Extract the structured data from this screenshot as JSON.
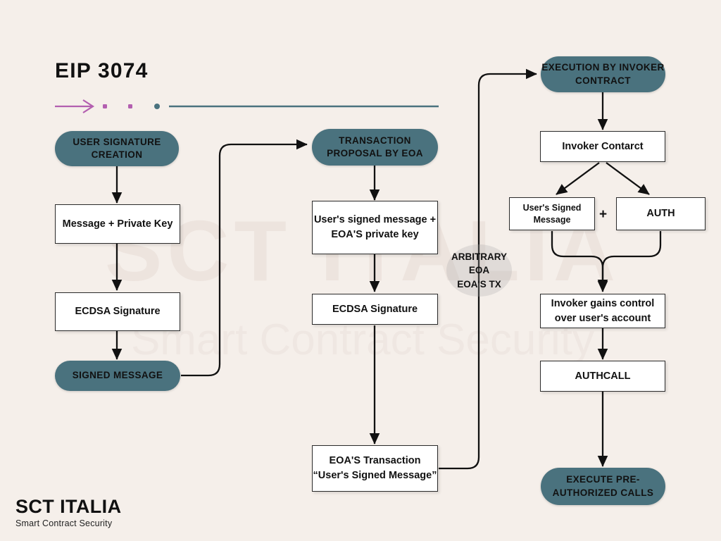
{
  "header": {
    "title": "EIP 3074",
    "divider": {
      "arrow_color": "#B35FB0",
      "dot1_color": "#B35FB0",
      "dot2_color": "#B35FB0",
      "dot3_color": "#4A727E",
      "line_color": "#4A727E"
    }
  },
  "theme": {
    "background": "#F5EFEA",
    "pill_fill": "#4A727E",
    "box_fill": "#FFFFFF",
    "box_border": "#2B2B2B",
    "text": "#111111",
    "blob_fill": "#AAAAAA",
    "connector": "#111111",
    "accent_purple": "#B35FB0"
  },
  "watermark": {
    "title": "SCT ITALIA",
    "subtitle": "Smart Contract Security"
  },
  "flow": {
    "columns": [
      {
        "name": "user-signature-creation",
        "nodes": [
          {
            "id": "user-signature-creation",
            "label": "USER SIGNATURE CREATION",
            "shape": "pill"
          },
          {
            "id": "message-private-key",
            "label": "Message + Private Key",
            "shape": "box"
          },
          {
            "id": "ecdsa-signature-1",
            "label": "ECDSA Signature",
            "shape": "box"
          },
          {
            "id": "signed-message",
            "label": "SIGNED MESSAGE",
            "shape": "pill"
          }
        ]
      },
      {
        "name": "transaction-proposal",
        "nodes": [
          {
            "id": "transaction-proposal-by-eoa",
            "label": "TRANSACTION PROPOSAL BY EOA",
            "shape": "pill"
          },
          {
            "id": "users-signed-message-eoa-key",
            "label": "User's signed message + EOA'S private key",
            "shape": "box"
          },
          {
            "id": "ecdsa-signature-2",
            "label": "ECDSA Signature",
            "shape": "box"
          },
          {
            "id": "eoas-transaction",
            "label": "EOA'S Transaction “User's Signed Message”",
            "shape": "box"
          }
        ]
      },
      {
        "name": "execution-by-invoker",
        "nodes": [
          {
            "id": "execution-by-invoker-contract",
            "label": "EXECUTION BY INVOKER CONTRACT",
            "shape": "pill"
          },
          {
            "id": "invoker-contarct",
            "label": "Invoker Contarct",
            "shape": "box"
          },
          {
            "id": "users-signed-message",
            "label": "User's Signed Message",
            "shape": "box"
          },
          {
            "id": "auth",
            "label": "AUTH",
            "shape": "box"
          },
          {
            "id": "invoker-gains-control",
            "label": "Invoker gains control over user's account",
            "shape": "box"
          },
          {
            "id": "authcall",
            "label": "AUTHCALL",
            "shape": "box"
          },
          {
            "id": "execute-pre-authorized-calls",
            "label": "EXECUTE PRE-AUTHORIZED CALLS",
            "shape": "pill"
          }
        ]
      }
    ],
    "midblob": {
      "id": "arbitrary-eoa",
      "label": "ARBITRARY EOA EOA'S TX",
      "line1": "ARBITRARY",
      "line2": "EOA",
      "line3": "EOA'S TX"
    },
    "combiner_symbol": "+"
  },
  "nodes": {
    "user_signature_creation": "USER SIGNATURE CREATION",
    "message_private_key": "Message + Private Key",
    "ecdsa_signature_1": "ECDSA Signature",
    "signed_message": "SIGNED MESSAGE",
    "transaction_proposal": "TRANSACTION PROPOSAL BY EOA",
    "users_signed_message_eoa_key": "User's signed message + EOA'S private key",
    "ecdsa_signature_2": "ECDSA Signature",
    "eoas_transaction": "EOA'S Transaction “User's Signed Message”",
    "execution_by_invoker": "EXECUTION BY INVOKER CONTRACT",
    "invoker_contract": "Invoker Contarct",
    "users_signed_message": "User's Signed Message",
    "auth": "AUTH",
    "invoker_gains_control": "Invoker gains control over user's account",
    "authcall": "AUTHCALL",
    "execute_pre_authorized_calls": "EXECUTE PRE-AUTHORIZED CALLS",
    "arbitrary_eoa": "ARBITRARY EOA EOA'S TX",
    "plus": "+"
  },
  "footer": {
    "logo_main": "SCT ITALIA",
    "logo_sub": "Smart Contract Security"
  }
}
